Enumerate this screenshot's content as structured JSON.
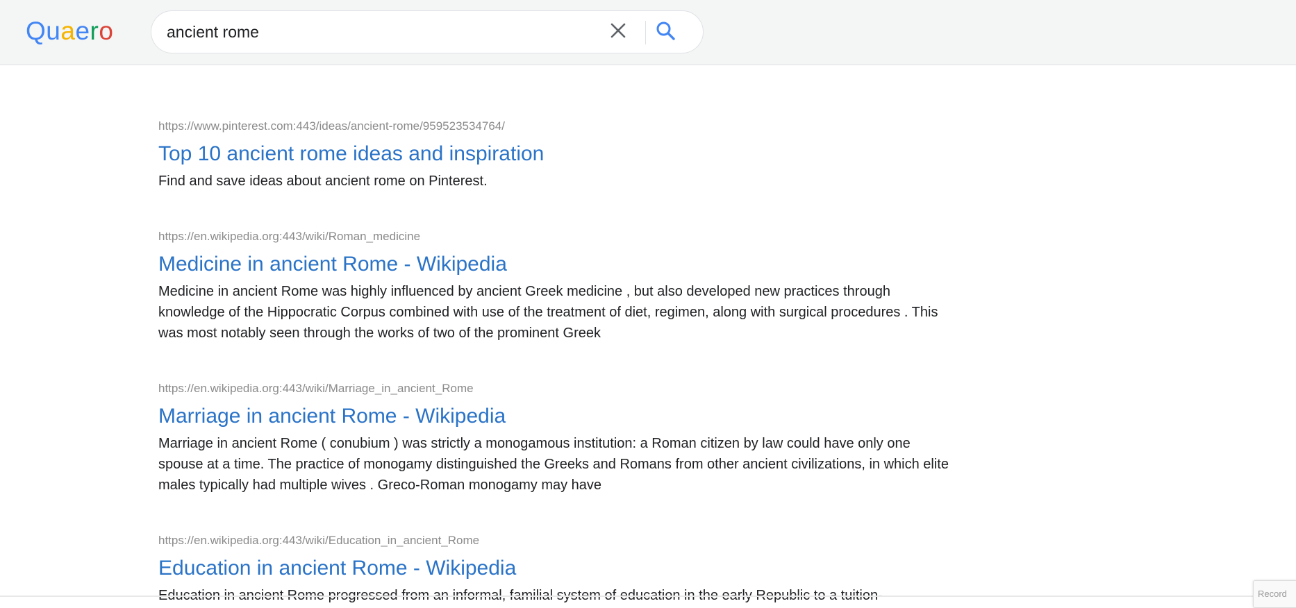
{
  "logo": {
    "letters": [
      {
        "char": "Q",
        "color": "#4285f4"
      },
      {
        "char": "u",
        "color": "#4285f4"
      },
      {
        "char": "a",
        "color": "#f4b400"
      },
      {
        "char": "e",
        "color": "#4285f4"
      },
      {
        "char": "r",
        "color": "#0f9d58"
      },
      {
        "char": "o",
        "color": "#db4437"
      }
    ]
  },
  "search": {
    "value": "ancient rome",
    "clear_icon": "close-icon",
    "search_icon": "search-icon"
  },
  "results": [
    {
      "url": "https://www.pinterest.com:443/ideas/ancient-rome/959523534764/",
      "title": "Top 10 ancient rome ideas and inspiration",
      "snippet": "Find and save ideas about ancient rome on Pinterest."
    },
    {
      "url": "https://en.wikipedia.org:443/wiki/Roman_medicine",
      "title": "Medicine in ancient Rome - Wikipedia",
      "snippet": "Medicine in ancient Rome was highly influenced by ancient Greek medicine , but also developed new practices through knowledge of the Hippocratic Corpus combined with use of the treatment of diet, regimen, along with surgical procedures . This was most notably seen through the works of two of the prominent Greek"
    },
    {
      "url": "https://en.wikipedia.org:443/wiki/Marriage_in_ancient_Rome",
      "title": "Marriage in ancient Rome - Wikipedia",
      "snippet": "Marriage in ancient Rome ( conubium ) was strictly a monogamous institution: a Roman citizen by law could have only one spouse at a time. The practice of monogamy distinguished the Greeks and Romans from other ancient civilizations, in which elite males typically had multiple wives . Greco-Roman monogamy may have"
    },
    {
      "url": "https://en.wikipedia.org:443/wiki/Education_in_ancient_Rome",
      "title": "Education in ancient Rome - Wikipedia",
      "snippet": "Education in ancient Rome progressed from an informal, familial system of education in the early Republic to a tuition-"
    }
  ],
  "corner_widget": {
    "label": "Record"
  },
  "colors": {
    "header_bg": "#f4f5f5",
    "link": "#2a73c7",
    "url": "#8a8a8a",
    "text": "#202124"
  }
}
